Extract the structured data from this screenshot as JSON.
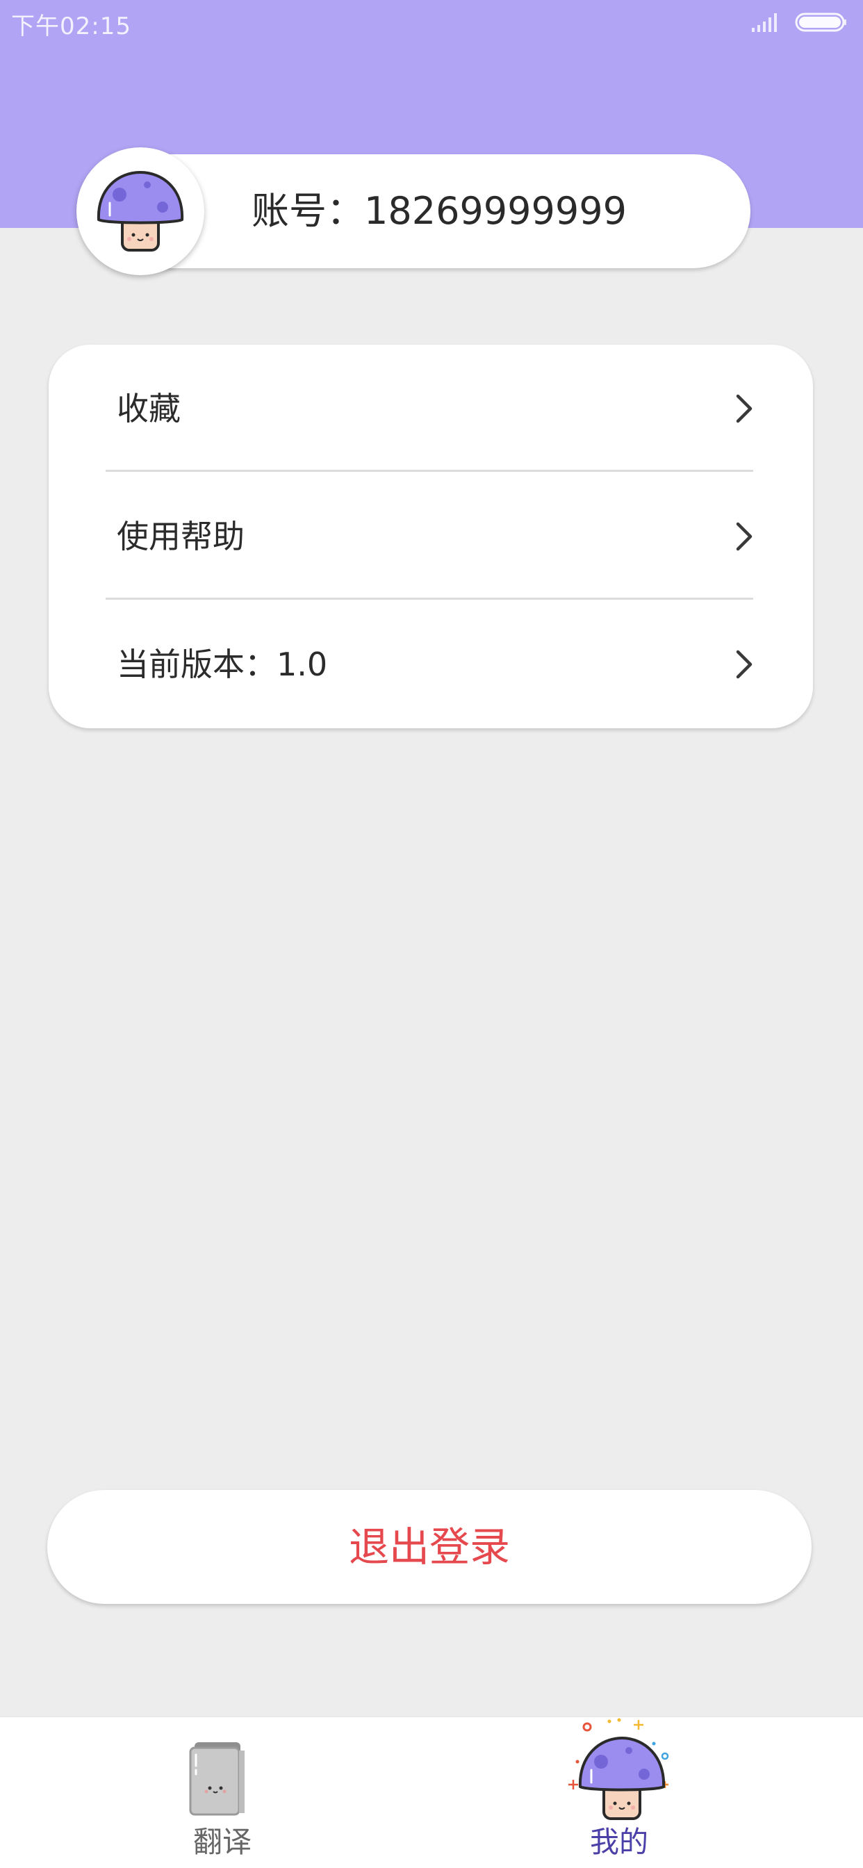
{
  "status_bar": {
    "time": "下午02:15"
  },
  "account": {
    "label": "账号：18269999999"
  },
  "menu": {
    "items": [
      {
        "label": "收藏"
      },
      {
        "label": "使用帮助"
      },
      {
        "label": "当前版本：1.0"
      }
    ]
  },
  "logout": {
    "label": "退出登录"
  },
  "tab_bar": {
    "tabs": [
      {
        "label": "翻译",
        "icon": "book-icon",
        "active": false
      },
      {
        "label": "我的",
        "icon": "mushroom-icon",
        "active": true
      }
    ]
  },
  "colors": {
    "header": "#b1a4f4",
    "background": "#ededed",
    "logout_text": "#e5484d",
    "active_tab": "#4b3fa8",
    "mushroom_cap": "#9b8cef"
  }
}
